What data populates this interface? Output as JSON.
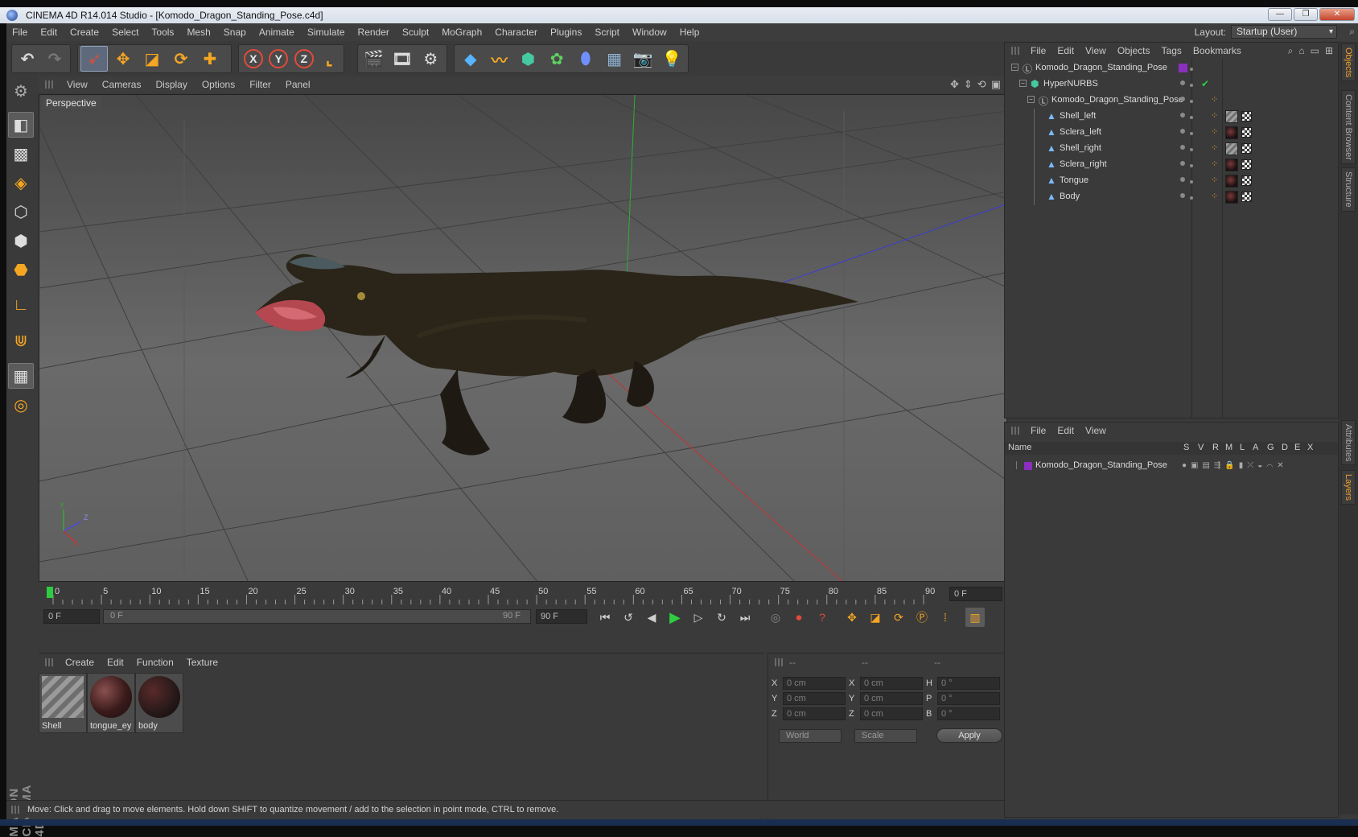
{
  "window": {
    "title": "CINEMA 4D R14.014 Studio - [Komodo_Dragon_Standing_Pose.c4d]",
    "minimize": "—",
    "restore": "❐",
    "close": "✕"
  },
  "menubar": {
    "items": [
      "File",
      "Edit",
      "Create",
      "Select",
      "Tools",
      "Mesh",
      "Snap",
      "Animate",
      "Simulate",
      "Render",
      "Sculpt",
      "MoGraph",
      "Character",
      "Plugins",
      "Script",
      "Window",
      "Help"
    ],
    "layout_label": "Layout:",
    "layout_value": "Startup (User)"
  },
  "toolbar": {
    "axis_x": "X",
    "axis_y": "Y",
    "axis_z": "Z"
  },
  "viewport": {
    "menu": [
      "View",
      "Cameras",
      "Display",
      "Options",
      "Filter",
      "Panel"
    ],
    "label": "Perspective",
    "axis_y": "Y",
    "axis_x": "X",
    "axis_z": "Z"
  },
  "timeline": {
    "ticks": [
      "0",
      "5",
      "10",
      "15",
      "20",
      "25",
      "30",
      "35",
      "40",
      "45",
      "50",
      "55",
      "60",
      "65",
      "70",
      "75",
      "80",
      "85",
      "90"
    ],
    "current_frame": "0 F",
    "start_field": "0 F",
    "slider_start": "0 F",
    "slider_end": "90 F",
    "end_field": "90 F"
  },
  "materials": {
    "menu": [
      "Create",
      "Edit",
      "Function",
      "Texture"
    ],
    "items": [
      {
        "label": "Shell",
        "type": "striped"
      },
      {
        "label": "tongue_ey",
        "type": "dark-red"
      },
      {
        "label": "body",
        "type": "dark"
      }
    ]
  },
  "coordinates": {
    "headers": [
      "--",
      "--",
      "--"
    ],
    "rows": [
      {
        "a": "X",
        "v1": "0 cm",
        "b": "X",
        "v2": "0 cm",
        "c": "H",
        "v3": "0 °"
      },
      {
        "a": "Y",
        "v1": "0 cm",
        "b": "Y",
        "v2": "0 cm",
        "c": "P",
        "v3": "0 °"
      },
      {
        "a": "Z",
        "v1": "0 cm",
        "b": "Z",
        "v2": "0 cm",
        "c": "B",
        "v3": "0 °"
      }
    ],
    "world": "World",
    "scale": "Scale",
    "apply": "Apply"
  },
  "objects": {
    "menu": [
      "File",
      "Edit",
      "View",
      "Objects",
      "Tags",
      "Bookmarks"
    ],
    "rows": [
      {
        "name": "Komodo_Dragon_Standing_Pose",
        "kind": "null",
        "level": 0,
        "tags": "layer"
      },
      {
        "name": "HyperNURBS",
        "kind": "nurbs",
        "level": 1,
        "tags": "check"
      },
      {
        "name": "Komodo_Dragon_Standing_Pose",
        "kind": "null",
        "level": 2,
        "tags": "phong"
      },
      {
        "name": "Shell_left",
        "kind": "poly",
        "level": 3,
        "tags": "shell"
      },
      {
        "name": "Sclera_left",
        "kind": "poly",
        "level": 3,
        "tags": "dark"
      },
      {
        "name": "Shell_right",
        "kind": "poly",
        "level": 3,
        "tags": "shell"
      },
      {
        "name": "Sclera_right",
        "kind": "poly",
        "level": 3,
        "tags": "dark"
      },
      {
        "name": "Tongue",
        "kind": "poly",
        "level": 3,
        "tags": "dark"
      },
      {
        "name": "Body",
        "kind": "poly",
        "level": 3,
        "tags": "dark"
      }
    ]
  },
  "layers": {
    "menu": [
      "File",
      "Edit",
      "View"
    ],
    "columns": [
      "Name",
      "S",
      "V",
      "R",
      "M",
      "L",
      "A",
      "G",
      "D",
      "E",
      "X"
    ],
    "rows": [
      {
        "name": "Komodo_Dragon_Standing_Pose",
        "color": "#8a2fc0"
      }
    ]
  },
  "side_tabs": [
    "Objects",
    "Content Browser",
    "Structure",
    "Attributes",
    "Layers"
  ],
  "status": "Move: Click and drag to move elements. Hold down SHIFT to quantize movement / add to the selection in point mode, CTRL to remove.",
  "colors": {
    "accent": "#f0a030",
    "timeline_marker": "#2ecc40",
    "layer": "#8a2fc0"
  }
}
